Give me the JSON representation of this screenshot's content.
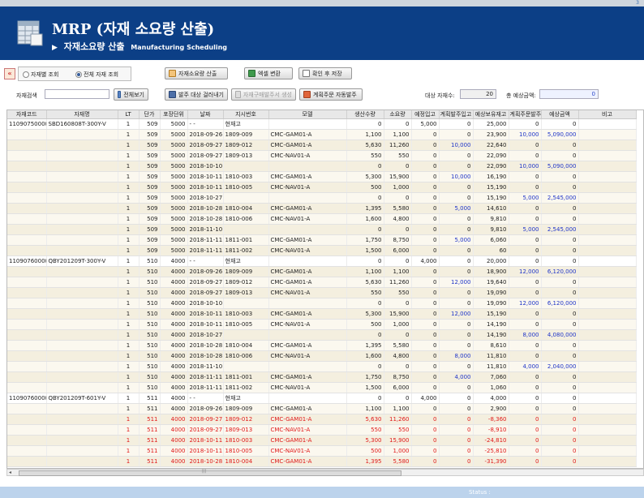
{
  "app": {
    "title": "MRP (자재 소요량 산출)",
    "subtitle_ko": "자재소요량 산출",
    "subtitle_en": "Manufacturing Scheduling",
    "top_corner": "3"
  },
  "toolbar": {
    "collapse": "«",
    "radio_material": "자재별 조회",
    "radio_all": "전체 자재 조회",
    "calc_button": "자재소요량 산출",
    "excel_button": "엑셀 변환",
    "save_button": "확인 후 저장",
    "search_label": "자재검색",
    "search_value": "",
    "view_all_button": "전체보기",
    "filter_button": "발주 대상 걸러내기",
    "po_create_button": "자재구매발주서 생성",
    "auto_order_button": "계획주문 자동발주",
    "count_label": "대상 자재수:",
    "count_value": "20",
    "amount_label": "총 예상금액:",
    "amount_value": "0"
  },
  "grid": {
    "columns": [
      "자재코드",
      "자재명",
      "LT",
      "단가",
      "포장단위",
      "날짜",
      "지시번호",
      "모델",
      "생산수량",
      "소요량",
      "예정입고",
      "계획발주입고",
      "예상보유재고",
      "계획주문발주",
      "예상금액",
      "비고"
    ],
    "rows": [
      {
        "code": "11090750000",
        "name": "SBD160808T-300Y-V",
        "lt": "1",
        "price": "509",
        "pack": "5000",
        "date": "- -",
        "order": "현재고",
        "model": "",
        "prod": "0",
        "req": "0",
        "sched": "5,000",
        "plan_in": "0",
        "stock": "25,000",
        "plan_po": "0",
        "amount": "0",
        "note": "",
        "first": true,
        "red": false
      },
      {
        "code": "",
        "name": "",
        "lt": "1",
        "price": "509",
        "pack": "5000",
        "date": "2018-09-26",
        "order": "1809-009",
        "model": "CMC-GAM01-A",
        "prod": "1,100",
        "req": "1,100",
        "sched": "0",
        "plan_in": "0",
        "stock": "23,900",
        "plan_po": "10,000",
        "amount": "5,090,000",
        "note": "",
        "red": false
      },
      {
        "code": "",
        "name": "",
        "lt": "1",
        "price": "509",
        "pack": "5000",
        "date": "2018-09-27",
        "order": "1809-012",
        "model": "CMC-GAM01-A",
        "prod": "5,630",
        "req": "11,260",
        "sched": "0",
        "plan_in": "10,000",
        "stock": "22,640",
        "plan_po": "0",
        "amount": "0",
        "note": "",
        "red": false
      },
      {
        "code": "",
        "name": "",
        "lt": "1",
        "price": "509",
        "pack": "5000",
        "date": "2018-09-27",
        "order": "1809-013",
        "model": "CMC-NAV01-A",
        "prod": "550",
        "req": "550",
        "sched": "0",
        "plan_in": "0",
        "stock": "22,090",
        "plan_po": "0",
        "amount": "0",
        "note": "",
        "red": false
      },
      {
        "code": "",
        "name": "",
        "lt": "1",
        "price": "509",
        "pack": "5000",
        "date": "2018-10-10",
        "order": "",
        "model": "",
        "prod": "0",
        "req": "0",
        "sched": "0",
        "plan_in": "0",
        "stock": "22,090",
        "plan_po": "10,000",
        "amount": "5,090,000",
        "note": "",
        "red": false
      },
      {
        "code": "",
        "name": "",
        "lt": "1",
        "price": "509",
        "pack": "5000",
        "date": "2018-10-11",
        "order": "1810-003",
        "model": "CMC-GAM01-A",
        "prod": "5,300",
        "req": "15,900",
        "sched": "0",
        "plan_in": "10,000",
        "stock": "16,190",
        "plan_po": "0",
        "amount": "0",
        "note": "",
        "red": false
      },
      {
        "code": "",
        "name": "",
        "lt": "1",
        "price": "509",
        "pack": "5000",
        "date": "2018-10-11",
        "order": "1810-005",
        "model": "CMC-NAV01-A",
        "prod": "500",
        "req": "1,000",
        "sched": "0",
        "plan_in": "0",
        "stock": "15,190",
        "plan_po": "0",
        "amount": "0",
        "note": "",
        "red": false
      },
      {
        "code": "",
        "name": "",
        "lt": "1",
        "price": "509",
        "pack": "5000",
        "date": "2018-10-27",
        "order": "",
        "model": "",
        "prod": "0",
        "req": "0",
        "sched": "0",
        "plan_in": "0",
        "stock": "15,190",
        "plan_po": "5,000",
        "amount": "2,545,000",
        "note": "",
        "red": false
      },
      {
        "code": "",
        "name": "",
        "lt": "1",
        "price": "509",
        "pack": "5000",
        "date": "2018-10-28",
        "order": "1810-004",
        "model": "CMC-GAM01-A",
        "prod": "1,395",
        "req": "5,580",
        "sched": "0",
        "plan_in": "5,000",
        "stock": "14,610",
        "plan_po": "0",
        "amount": "0",
        "note": "",
        "red": false
      },
      {
        "code": "",
        "name": "",
        "lt": "1",
        "price": "509",
        "pack": "5000",
        "date": "2018-10-28",
        "order": "1810-006",
        "model": "CMC-NAV01-A",
        "prod": "1,600",
        "req": "4,800",
        "sched": "0",
        "plan_in": "0",
        "stock": "9,810",
        "plan_po": "0",
        "amount": "0",
        "note": "",
        "red": false
      },
      {
        "code": "",
        "name": "",
        "lt": "1",
        "price": "509",
        "pack": "5000",
        "date": "2018-11-10",
        "order": "",
        "model": "",
        "prod": "0",
        "req": "0",
        "sched": "0",
        "plan_in": "0",
        "stock": "9,810",
        "plan_po": "5,000",
        "amount": "2,545,000",
        "note": "",
        "red": false
      },
      {
        "code": "",
        "name": "",
        "lt": "1",
        "price": "509",
        "pack": "5000",
        "date": "2018-11-11",
        "order": "1811-001",
        "model": "CMC-GAM01-A",
        "prod": "1,750",
        "req": "8,750",
        "sched": "0",
        "plan_in": "5,000",
        "stock": "6,060",
        "plan_po": "0",
        "amount": "0",
        "note": "",
        "red": false
      },
      {
        "code": "",
        "name": "",
        "lt": "1",
        "price": "509",
        "pack": "5000",
        "date": "2018-11-11",
        "order": "1811-002",
        "model": "CMC-NAV01-A",
        "prod": "1,500",
        "req": "6,000",
        "sched": "0",
        "plan_in": "0",
        "stock": "60",
        "plan_po": "0",
        "amount": "0",
        "note": "",
        "red": false
      },
      {
        "code": "11090760000",
        "name": "QBY201209T-300Y-V",
        "lt": "1",
        "price": "510",
        "pack": "4000",
        "date": "- -",
        "order": "현재고",
        "model": "",
        "prod": "0",
        "req": "0",
        "sched": "4,000",
        "plan_in": "0",
        "stock": "20,000",
        "plan_po": "0",
        "amount": "0",
        "note": "",
        "first": true,
        "red": false
      },
      {
        "code": "",
        "name": "",
        "lt": "1",
        "price": "510",
        "pack": "4000",
        "date": "2018-09-26",
        "order": "1809-009",
        "model": "CMC-GAM01-A",
        "prod": "1,100",
        "req": "1,100",
        "sched": "0",
        "plan_in": "0",
        "stock": "18,900",
        "plan_po": "12,000",
        "amount": "6,120,000",
        "note": "",
        "red": false
      },
      {
        "code": "",
        "name": "",
        "lt": "1",
        "price": "510",
        "pack": "4000",
        "date": "2018-09-27",
        "order": "1809-012",
        "model": "CMC-GAM01-A",
        "prod": "5,630",
        "req": "11,260",
        "sched": "0",
        "plan_in": "12,000",
        "stock": "19,640",
        "plan_po": "0",
        "amount": "0",
        "note": "",
        "red": false
      },
      {
        "code": "",
        "name": "",
        "lt": "1",
        "price": "510",
        "pack": "4000",
        "date": "2018-09-27",
        "order": "1809-013",
        "model": "CMC-NAV01-A",
        "prod": "550",
        "req": "550",
        "sched": "0",
        "plan_in": "0",
        "stock": "19,090",
        "plan_po": "0",
        "amount": "0",
        "note": "",
        "red": false
      },
      {
        "code": "",
        "name": "",
        "lt": "1",
        "price": "510",
        "pack": "4000",
        "date": "2018-10-10",
        "order": "",
        "model": "",
        "prod": "0",
        "req": "0",
        "sched": "0",
        "plan_in": "0",
        "stock": "19,090",
        "plan_po": "12,000",
        "amount": "6,120,000",
        "note": "",
        "red": false
      },
      {
        "code": "",
        "name": "",
        "lt": "1",
        "price": "510",
        "pack": "4000",
        "date": "2018-10-11",
        "order": "1810-003",
        "model": "CMC-GAM01-A",
        "prod": "5,300",
        "req": "15,900",
        "sched": "0",
        "plan_in": "12,000",
        "stock": "15,190",
        "plan_po": "0",
        "amount": "0",
        "note": "",
        "red": false
      },
      {
        "code": "",
        "name": "",
        "lt": "1",
        "price": "510",
        "pack": "4000",
        "date": "2018-10-11",
        "order": "1810-005",
        "model": "CMC-NAV01-A",
        "prod": "500",
        "req": "1,000",
        "sched": "0",
        "plan_in": "0",
        "stock": "14,190",
        "plan_po": "0",
        "amount": "0",
        "note": "",
        "red": false
      },
      {
        "code": "",
        "name": "",
        "lt": "1",
        "price": "510",
        "pack": "4000",
        "date": "2018-10-27",
        "order": "",
        "model": "",
        "prod": "0",
        "req": "0",
        "sched": "0",
        "plan_in": "0",
        "stock": "14,190",
        "plan_po": "8,000",
        "amount": "4,080,000",
        "note": "",
        "red": false
      },
      {
        "code": "",
        "name": "",
        "lt": "1",
        "price": "510",
        "pack": "4000",
        "date": "2018-10-28",
        "order": "1810-004",
        "model": "CMC-GAM01-A",
        "prod": "1,395",
        "req": "5,580",
        "sched": "0",
        "plan_in": "0",
        "stock": "8,610",
        "plan_po": "0",
        "amount": "0",
        "note": "",
        "red": false
      },
      {
        "code": "",
        "name": "",
        "lt": "1",
        "price": "510",
        "pack": "4000",
        "date": "2018-10-28",
        "order": "1810-006",
        "model": "CMC-NAV01-A",
        "prod": "1,600",
        "req": "4,800",
        "sched": "0",
        "plan_in": "8,000",
        "stock": "11,810",
        "plan_po": "0",
        "amount": "0",
        "note": "",
        "red": false
      },
      {
        "code": "",
        "name": "",
        "lt": "1",
        "price": "510",
        "pack": "4000",
        "date": "2018-11-10",
        "order": "",
        "model": "",
        "prod": "0",
        "req": "0",
        "sched": "0",
        "plan_in": "0",
        "stock": "11,810",
        "plan_po": "4,000",
        "amount": "2,040,000",
        "note": "",
        "red": false
      },
      {
        "code": "",
        "name": "",
        "lt": "1",
        "price": "510",
        "pack": "4000",
        "date": "2018-11-11",
        "order": "1811-001",
        "model": "CMC-GAM01-A",
        "prod": "1,750",
        "req": "8,750",
        "sched": "0",
        "plan_in": "4,000",
        "stock": "7,060",
        "plan_po": "0",
        "amount": "0",
        "note": "",
        "red": false
      },
      {
        "code": "",
        "name": "",
        "lt": "1",
        "price": "510",
        "pack": "4000",
        "date": "2018-11-11",
        "order": "1811-002",
        "model": "CMC-NAV01-A",
        "prod": "1,500",
        "req": "6,000",
        "sched": "0",
        "plan_in": "0",
        "stock": "1,060",
        "plan_po": "0",
        "amount": "0",
        "note": "",
        "red": false
      },
      {
        "code": "11090760000",
        "name": "QBY201209T-601Y-V",
        "lt": "1",
        "price": "511",
        "pack": "4000",
        "date": "- -",
        "order": "현재고",
        "model": "",
        "prod": "0",
        "req": "0",
        "sched": "4,000",
        "plan_in": "0",
        "stock": "4,000",
        "plan_po": "0",
        "amount": "0",
        "note": "",
        "first": true,
        "red": false
      },
      {
        "code": "",
        "name": "",
        "lt": "1",
        "price": "511",
        "pack": "4000",
        "date": "2018-09-26",
        "order": "1809-009",
        "model": "CMC-GAM01-A",
        "prod": "1,100",
        "req": "1,100",
        "sched": "0",
        "plan_in": "0",
        "stock": "2,900",
        "plan_po": "0",
        "amount": "0",
        "note": "",
        "red": false
      },
      {
        "code": "",
        "name": "",
        "lt": "1",
        "price": "511",
        "pack": "4000",
        "date": "2018-09-27",
        "order": "1809-012",
        "model": "CMC-GAM01-A",
        "prod": "5,630",
        "req": "11,260",
        "sched": "0",
        "plan_in": "0",
        "stock": "-8,360",
        "plan_po": "0",
        "amount": "0",
        "note": "",
        "red": true
      },
      {
        "code": "",
        "name": "",
        "lt": "1",
        "price": "511",
        "pack": "4000",
        "date": "2018-09-27",
        "order": "1809-013",
        "model": "CMC-NAV01-A",
        "prod": "550",
        "req": "550",
        "sched": "0",
        "plan_in": "0",
        "stock": "-8,910",
        "plan_po": "0",
        "amount": "0",
        "note": "",
        "red": true
      },
      {
        "code": "",
        "name": "",
        "lt": "1",
        "price": "511",
        "pack": "4000",
        "date": "2018-10-11",
        "order": "1810-003",
        "model": "CMC-GAM01-A",
        "prod": "5,300",
        "req": "15,900",
        "sched": "0",
        "plan_in": "0",
        "stock": "-24,810",
        "plan_po": "0",
        "amount": "0",
        "note": "",
        "red": true
      },
      {
        "code": "",
        "name": "",
        "lt": "1",
        "price": "511",
        "pack": "4000",
        "date": "2018-10-11",
        "order": "1810-005",
        "model": "CMC-NAV01-A",
        "prod": "500",
        "req": "1,000",
        "sched": "0",
        "plan_in": "0",
        "stock": "-25,810",
        "plan_po": "0",
        "amount": "0",
        "note": "",
        "red": true
      },
      {
        "code": "",
        "name": "",
        "lt": "1",
        "price": "511",
        "pack": "4000",
        "date": "2018-10-28",
        "order": "1810-004",
        "model": "CMC-GAM01-A",
        "prod": "1,395",
        "req": "5,580",
        "sched": "0",
        "plan_in": "0",
        "stock": "-31,390",
        "plan_po": "0",
        "amount": "0",
        "note": "",
        "red": true
      }
    ]
  },
  "scroll": {
    "left_arrow": "◂",
    "grip": "|||"
  },
  "status": {
    "text": "Status :"
  },
  "colors": {
    "header_bg": "#0c3f86",
    "plan_blue": "#2035c8",
    "shortage_red": "#e01919",
    "status_bar": "#bcd3ec"
  }
}
